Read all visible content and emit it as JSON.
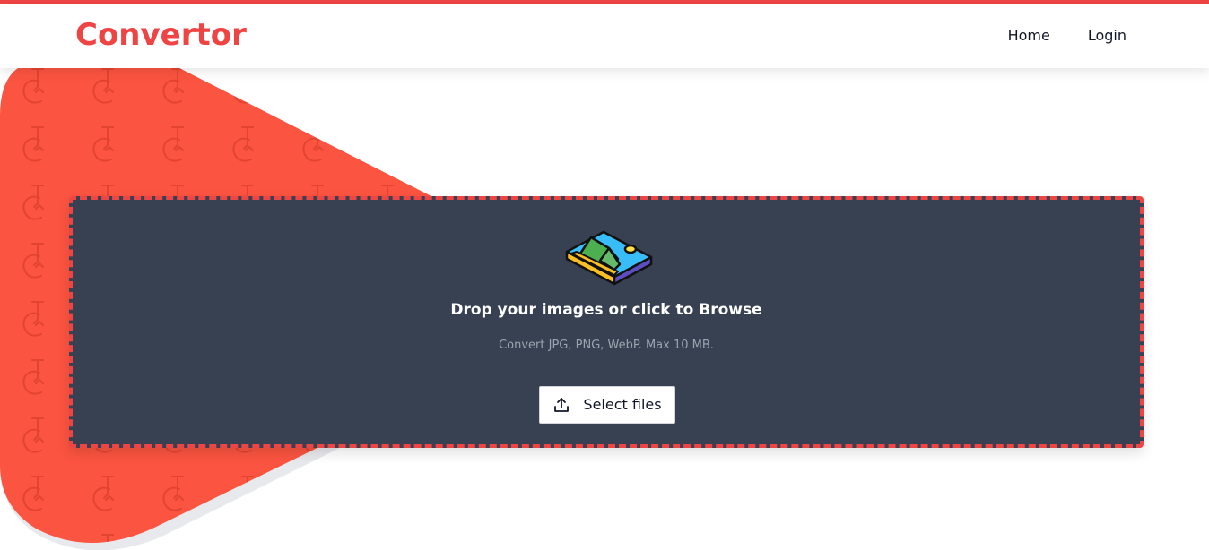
{
  "header": {
    "logo": "Convertor",
    "nav": [
      {
        "label": "Home"
      },
      {
        "label": "Login"
      }
    ]
  },
  "dropzone": {
    "title": "Drop your images or click to Browse",
    "subtitle": "Convert JPG, PNG, WebP. Max 10 MB.",
    "select_button": "Select files",
    "icon": "image-icon"
  },
  "colors": {
    "brand": "#ef4444",
    "hero_shape": "#fb5440",
    "dropzone_bg": "#374151",
    "subtitle": "#9ca3af"
  },
  "icons": {
    "upload": "upload-icon",
    "pattern": "convertor-pattern-icon"
  }
}
